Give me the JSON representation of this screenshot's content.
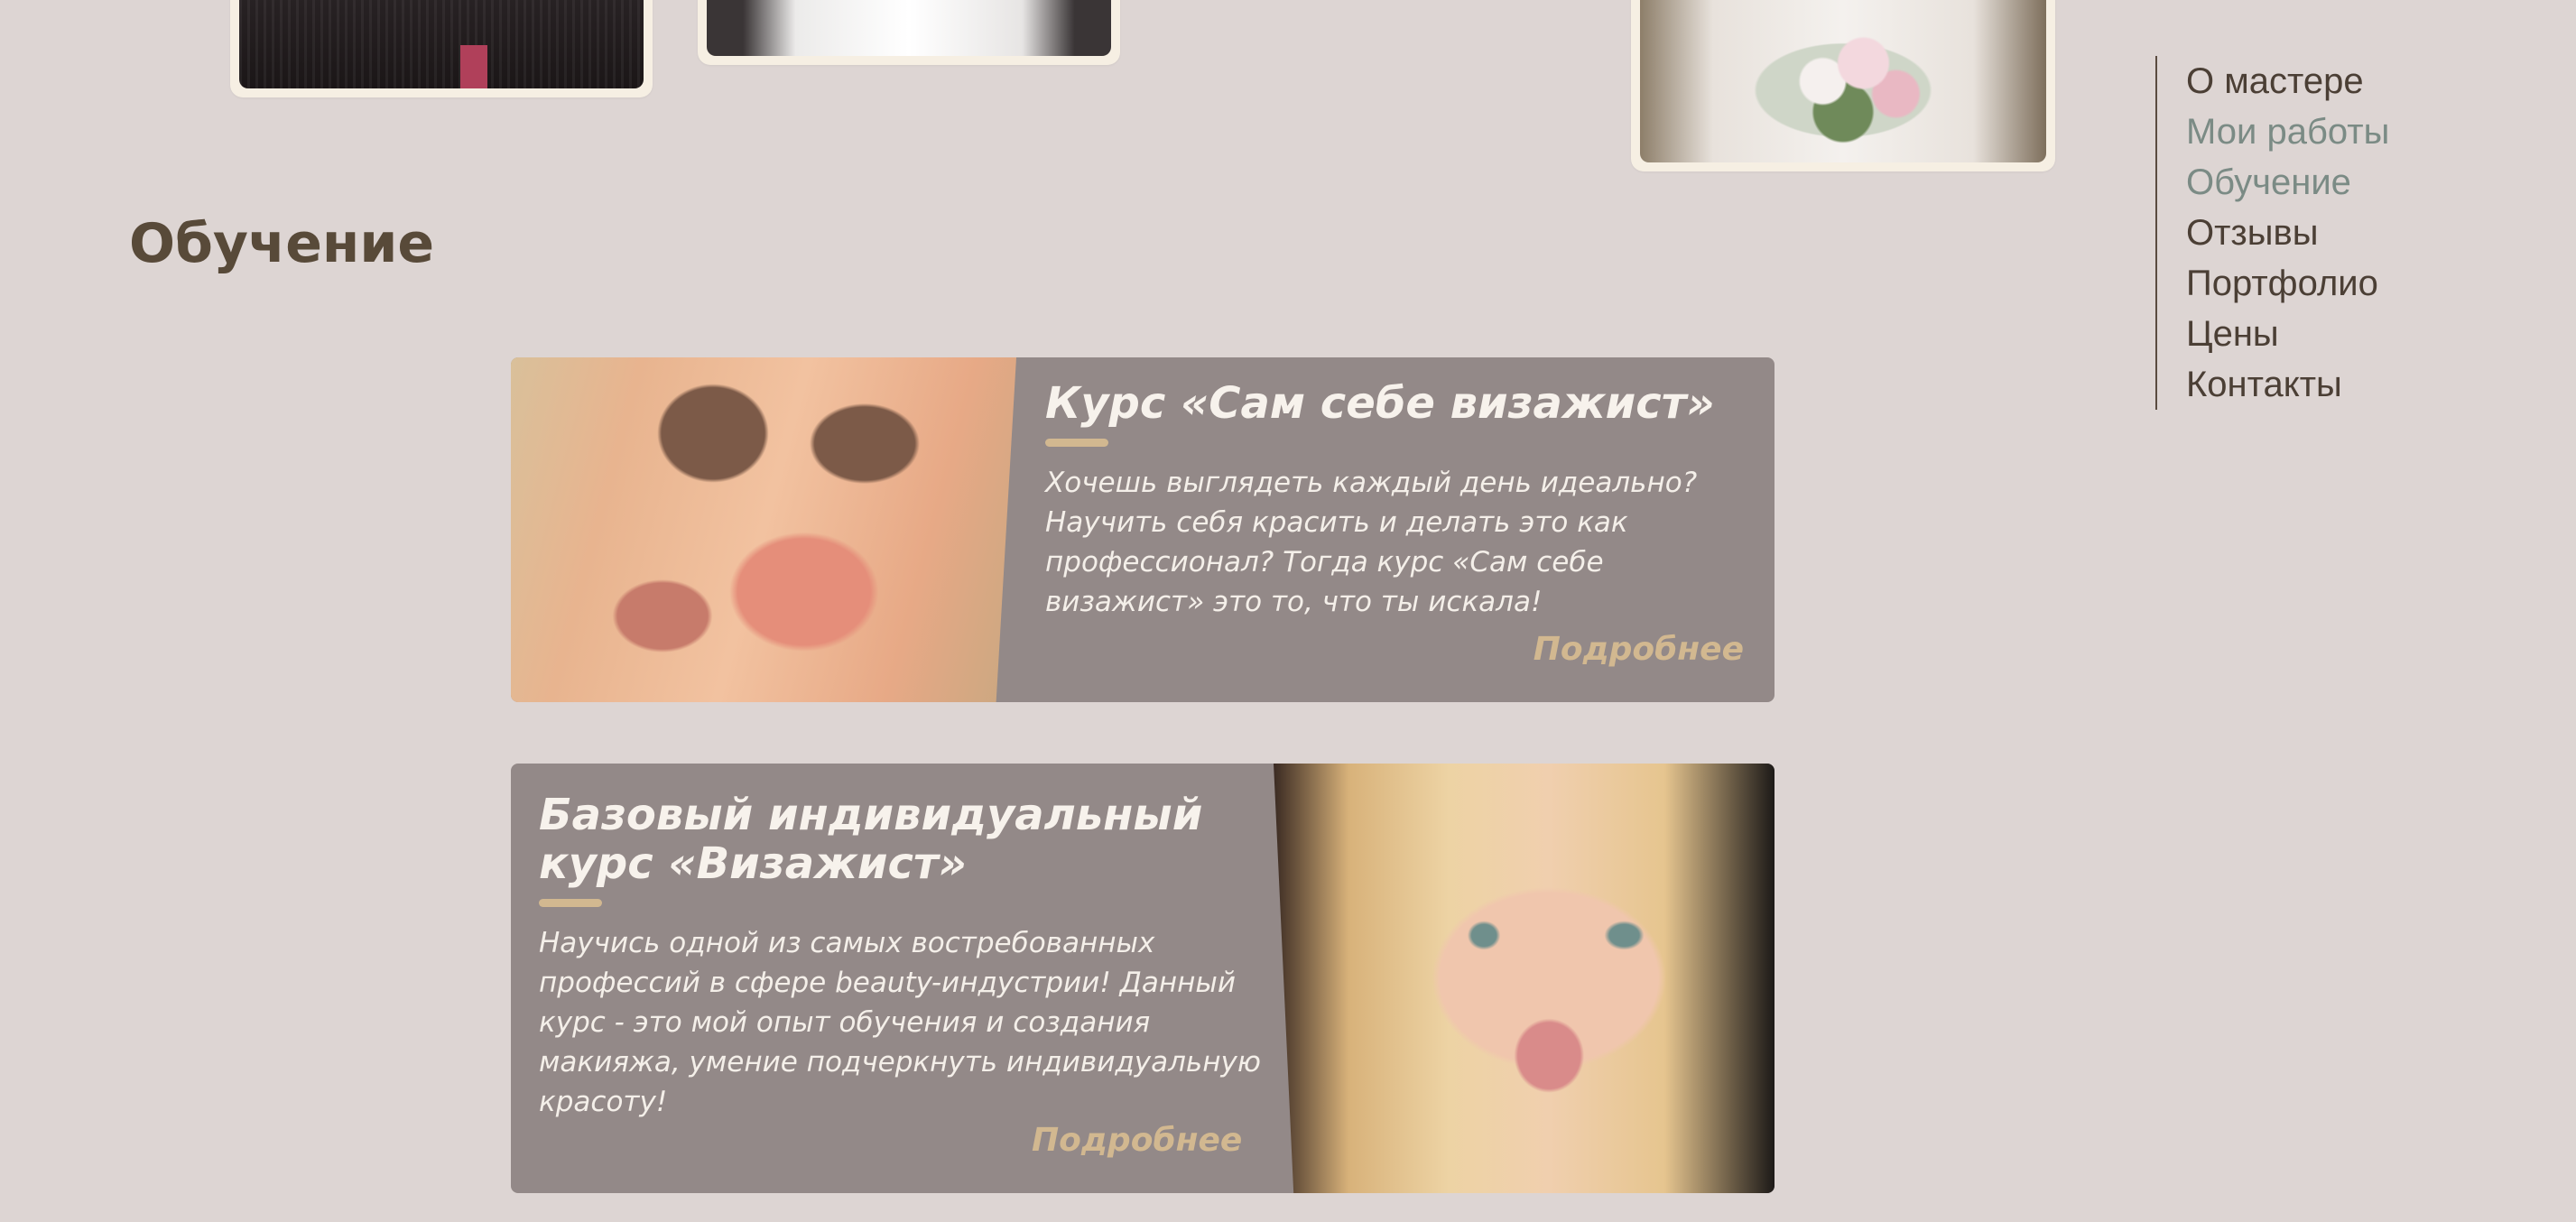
{
  "section": {
    "title": "Обучение"
  },
  "nav": {
    "items": [
      {
        "label": "О мастере",
        "active": false
      },
      {
        "label": "Мои работы",
        "active": true
      },
      {
        "label": "Обучение",
        "active": true
      },
      {
        "label": "Отзывы",
        "active": false
      },
      {
        "label": "Портфолио",
        "active": false
      },
      {
        "label": "Цены",
        "active": false
      },
      {
        "label": "Контакты",
        "active": false
      }
    ]
  },
  "courses": [
    {
      "title": "Курс «Сам себе визажист»",
      "description": "Хочешь выглядеть каждый день идеально? Научить себя красить и делать это как профессионал? Тогда курс «Сам себе визажист» это то, что ты искала!",
      "more_label": "Подробнее"
    },
    {
      "title": "Базовый индивидуальный курс «Визажист»",
      "description": "Научись одной из самых востребованных профессий в сфере beauty-индустрии! Данный курс - это мой опыт обучения и создания макияжа, умение подчеркнуть индивидуальную красоту!",
      "more_label": "Подробнее"
    }
  ],
  "colors": {
    "background": "#ddd5d3",
    "heading": "#584a39",
    "nav_text": "#4b3f35",
    "nav_active": "#7b8b85",
    "card_background": "#938988",
    "accent_gold": "#d2b890",
    "card_text": "#f7f2ec",
    "frame": "#f6efe3"
  }
}
